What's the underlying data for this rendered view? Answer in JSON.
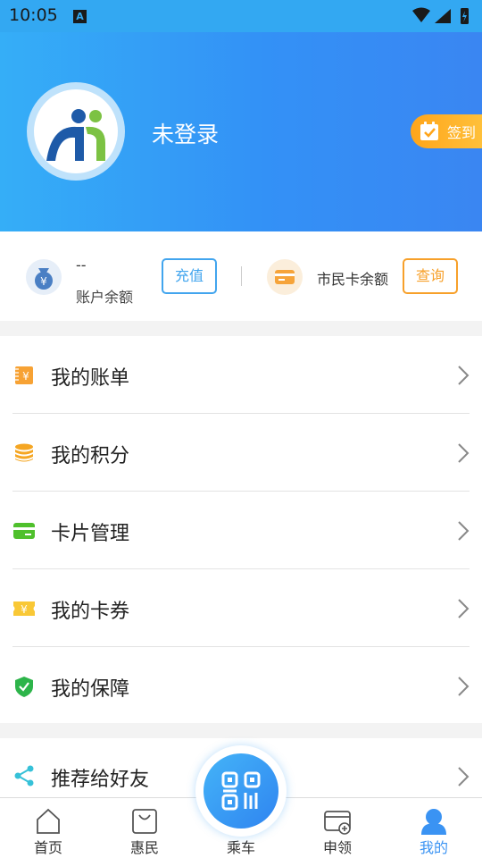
{
  "status_bar": {
    "time": "10:05",
    "notification_icon": "A"
  },
  "header": {
    "avatar_icon": "app-logo-icon",
    "login_status": "未登录",
    "signin_label": "签到"
  },
  "balance": {
    "account_value": "--",
    "account_label": "账户余额",
    "recharge_label": "充值",
    "citizen_card_label": "市民卡余额",
    "query_label": "查询"
  },
  "menu": {
    "items": [
      {
        "label": "我的账单",
        "icon": "bill-icon"
      },
      {
        "label": "我的积分",
        "icon": "coins-icon"
      },
      {
        "label": "卡片管理",
        "icon": "card-icon"
      },
      {
        "label": "我的卡券",
        "icon": "coupon-icon"
      },
      {
        "label": "我的保障",
        "icon": "shield-check-icon"
      }
    ]
  },
  "share": {
    "label": "推荐给好友",
    "icon": "share-icon"
  },
  "tabbar": {
    "tabs": [
      {
        "label": "首页",
        "icon": "home-icon"
      },
      {
        "label": "惠民",
        "icon": "shopping-bag-icon"
      },
      {
        "label": "乘车",
        "icon": "qr-code-icon"
      },
      {
        "label": "申领",
        "icon": "card-add-icon"
      },
      {
        "label": "我的",
        "icon": "user-icon"
      }
    ],
    "active": "我的"
  },
  "colors": {
    "header_start": "#35aef7",
    "header_end": "#3a86f2",
    "accent_blue": "#42a5ee",
    "accent_orange": "#f7a02a",
    "active_tab": "#3a93f3"
  }
}
